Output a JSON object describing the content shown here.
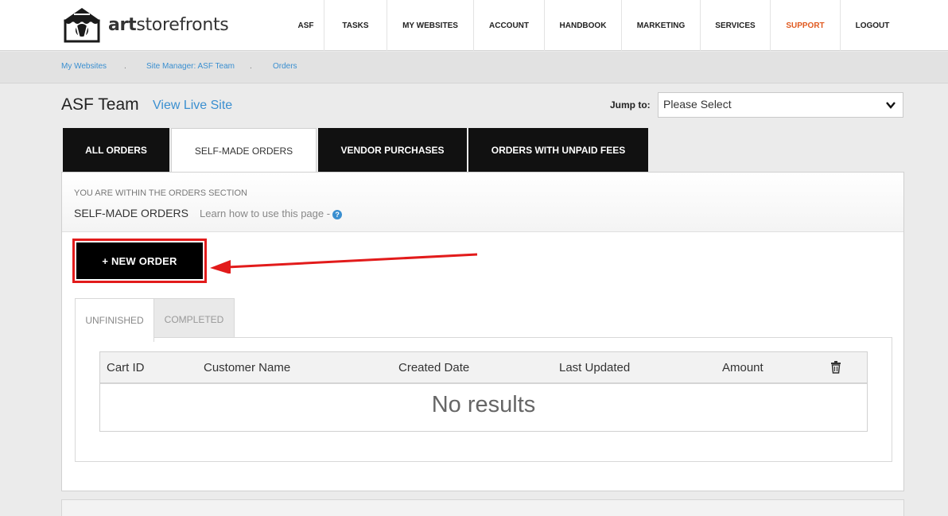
{
  "brand": {
    "text_bold": "art",
    "text_rest": "storefronts"
  },
  "nav": [
    {
      "label": "ASF",
      "name": "nav-asf"
    },
    {
      "label": "TASKS",
      "name": "nav-tasks"
    },
    {
      "label": "MY WEBSITES",
      "name": "nav-my-websites"
    },
    {
      "label": "ACCOUNT",
      "name": "nav-account"
    },
    {
      "label": "HANDBOOK",
      "name": "nav-handbook"
    },
    {
      "label": "MARKETING",
      "name": "nav-marketing"
    },
    {
      "label": "SERVICES",
      "name": "nav-services"
    },
    {
      "label": "SUPPORT",
      "name": "nav-support"
    },
    {
      "label": "LOGOUT",
      "name": "nav-logout"
    }
  ],
  "breadcrumb": {
    "items": [
      "My Websites",
      "Site Manager: ASF Team",
      "Orders"
    ],
    "separator": "."
  },
  "header": {
    "site_title": "ASF Team",
    "view_live": "View Live Site",
    "jump_label": "Jump to:",
    "jump_value": "Please Select"
  },
  "tabs": [
    "ALL ORDERS",
    "SELF-MADE ORDERS",
    "VENDOR PURCHASES",
    "ORDERS WITH UNPAID FEES"
  ],
  "section": {
    "note": "YOU ARE WITHIN THE ORDERS SECTION",
    "title": "SELF-MADE ORDERS",
    "learn": "Learn how to use this page -",
    "help_glyph": "?"
  },
  "new_order_label": "+ NEW ORDER",
  "inner_tabs": [
    "UNFINISHED",
    "COMPLETED"
  ],
  "table": {
    "columns": [
      "Cart ID",
      "Customer Name",
      "Created Date",
      "Last Updated",
      "Amount"
    ],
    "empty_text": "No results"
  },
  "colors": {
    "accent": "#3a8fd0",
    "support": "#e05a20",
    "highlight": "#e21b1b",
    "tab_dark": "#111111"
  }
}
